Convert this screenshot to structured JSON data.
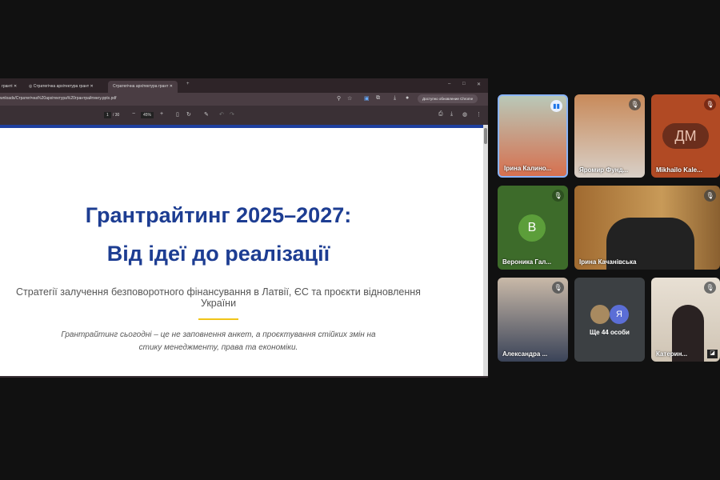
{
  "browser": {
    "tabs": [
      {
        "label": "гранті"
      },
      {
        "label": "Стратегічна архітектура грант"
      },
      {
        "label": "Стратегічна архітектура грант"
      }
    ],
    "url": "wnloads/Стратегічна%20архітектура%20грантрайтингу.pptx.pdf",
    "update_button": "Доступно обновление Chrome",
    "pdf": {
      "page": "1",
      "total": "/ 30",
      "zoom": "45%"
    }
  },
  "slide": {
    "title_line1": "Грантрайтинг 2025–2027:",
    "title_line2": "Від ідеї до реалізації",
    "subtitle": "Стратегії залучення безповоротного фінансування в Латвії, ЄС та проєкти відновлення України",
    "quote_line1": "Грантрайтинг сьогодні – це не заповнення анкет, а проєктування стійких змін на",
    "quote_line2": "стику менеджменту, права та економіки."
  },
  "participants": [
    {
      "name": "Ірина Калино...",
      "status": "speaking"
    },
    {
      "name": "Яромир Фунд...",
      "status": "muted"
    },
    {
      "name": "Mikhailo Kale...",
      "status": "muted",
      "initials": "ДМ"
    },
    {
      "name": "Вероника Гал...",
      "status": "muted",
      "initial": "В"
    },
    {
      "name": "Ірина Качанівська",
      "status": "muted"
    },
    {
      "name": "Александра ...",
      "status": "muted"
    },
    {
      "name": "Ще 44 особи",
      "initial": "Я"
    },
    {
      "name": "Катерин...",
      "status": "muted"
    }
  ],
  "colors": {
    "accent": "#1d3d92",
    "highlight": "#f0c419",
    "active_border": "#8ab4f8"
  }
}
